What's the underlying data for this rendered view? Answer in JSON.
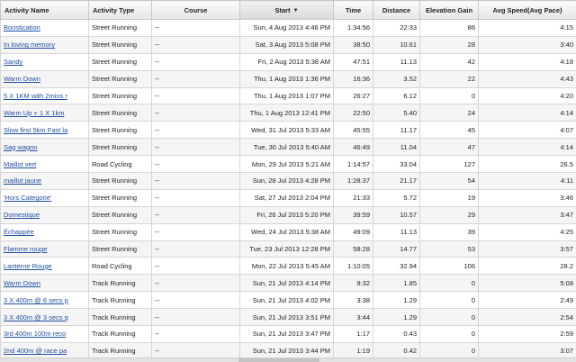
{
  "columns": {
    "name": "Activity Name",
    "type": "Activity Type",
    "course": "Course",
    "start": "Start",
    "time": "Time",
    "distance": "Distance",
    "elevation": "Elevation Gain",
    "speed": "Avg Speed(Avg Pace)"
  },
  "sort_icon": "sort-descending-icon",
  "rows": [
    {
      "name": "Bonstication",
      "type": "Street Running",
      "course": "--",
      "start": "Sun, 4 Aug 2013 4:46 PM",
      "time": "1:34:56",
      "distance": "22:33",
      "elevation": "86",
      "speed": "4:15"
    },
    {
      "name": "In loving memory",
      "type": "Street Running",
      "course": "--",
      "start": "Sat, 3 Aug 2013 5:08 PM",
      "time": "38:50",
      "distance": "10.61",
      "elevation": "28",
      "speed": "3:40"
    },
    {
      "name": "Sandy",
      "type": "Street Running",
      "course": "--",
      "start": "Fri, 2 Aug 2013 5:38 AM",
      "time": "47:51",
      "distance": "11.13",
      "elevation": "42",
      "speed": "4:18"
    },
    {
      "name": "Warm Down",
      "type": "Street Running",
      "course": "--",
      "start": "Thu, 1 Aug 2013 1:36 PM",
      "time": "16:36",
      "distance": "3.52",
      "elevation": "22",
      "speed": "4:43"
    },
    {
      "name": "5 X 1KM with 2mins r",
      "type": "Street Running",
      "course": "--",
      "start": "Thu, 1 Aug 2013 1:07 PM",
      "time": "26:27",
      "distance": "6.12",
      "elevation": "0",
      "speed": "4:20"
    },
    {
      "name": "Warm Up + 1 X 1km",
      "type": "Street Running",
      "course": "--",
      "start": "Thu, 1 Aug 2013 12:41 PM",
      "time": "22:50",
      "distance": "5.40",
      "elevation": "24",
      "speed": "4:14"
    },
    {
      "name": "Slow first 5km Fast la",
      "type": "Street Running",
      "course": "--",
      "start": "Wed, 31 Jul 2013 5:33 AM",
      "time": "45:55",
      "distance": "11.17",
      "elevation": "45",
      "speed": "4:07"
    },
    {
      "name": "Sag wagon",
      "type": "Street Running",
      "course": "--",
      "start": "Tue, 30 Jul 2013 5:40 AM",
      "time": "46:49",
      "distance": "11.04",
      "elevation": "47",
      "speed": "4:14"
    },
    {
      "name": "Maillot vert",
      "type": "Road Cycling",
      "course": "--",
      "start": "Mon, 29 Jul 2013 5:21 AM",
      "time": "1:14:57",
      "distance": "33.04",
      "elevation": "127",
      "speed": "26.5"
    },
    {
      "name": "maillot jaune",
      "type": "Street Running",
      "course": "--",
      "start": "Sun, 28 Jul 2013 4:28 PM",
      "time": "1:28:37",
      "distance": "21.17",
      "elevation": "54",
      "speed": "4:11"
    },
    {
      "name": "'Hors Categorie'",
      "type": "Street Running",
      "course": "--",
      "start": "Sat, 27 Jul 2013 2:04 PM",
      "time": "21:33",
      "distance": "5.72",
      "elevation": "19",
      "speed": "3:46"
    },
    {
      "name": "Domestique",
      "type": "Street Running",
      "course": "--",
      "start": "Fri, 26 Jul 2013 5:20 PM",
      "time": "39:59",
      "distance": "10.57",
      "elevation": "29",
      "speed": "3:47"
    },
    {
      "name": "Échappée",
      "type": "Street Running",
      "course": "--",
      "start": "Wed, 24 Jul 2013 5:38 AM",
      "time": "49:09",
      "distance": "11.13",
      "elevation": "39",
      "speed": "4:25"
    },
    {
      "name": "Flamme rouge",
      "type": "Street Running",
      "course": "--",
      "start": "Tue, 23 Jul 2013 12:28 PM",
      "time": "58:28",
      "distance": "14.77",
      "elevation": "53",
      "speed": "3:57"
    },
    {
      "name": "Lanterne Rouge",
      "type": "Road Cycling",
      "course": "--",
      "start": "Mon, 22 Jul 2013 5:45 AM",
      "time": "1:10:05",
      "distance": "32.94",
      "elevation": "106",
      "speed": "28.2"
    },
    {
      "name": "Warm Down",
      "type": "Track Running",
      "course": "--",
      "start": "Sun, 21 Jul 2013 4:14 PM",
      "time": "9:32",
      "distance": "1.85",
      "elevation": "0",
      "speed": "5:08"
    },
    {
      "name": "3 X 400m @ 6 secs p",
      "type": "Track Running",
      "course": "--",
      "start": "Sun, 21 Jul 2013 4:02 PM",
      "time": "3:38",
      "distance": "1.29",
      "elevation": "0",
      "speed": "2:49"
    },
    {
      "name": "3 X 400m @ 3 secs q",
      "type": "Track Running",
      "course": "--",
      "start": "Sun, 21 Jul 2013 3:51 PM",
      "time": "3:44",
      "distance": "1.29",
      "elevation": "0",
      "speed": "2:54"
    },
    {
      "name": "3rd 400m 100m reco",
      "type": "Track Running",
      "course": "--",
      "start": "Sun, 21 Jul 2013 3:47 PM",
      "time": "1:17",
      "distance": "0.43",
      "elevation": "0",
      "speed": "2:59"
    },
    {
      "name": "2nd 400m @ race pa",
      "type": "Track Running",
      "course": "--",
      "start": "Sun, 21 Jul 2013 3:44 PM",
      "time": "1:19",
      "distance": "0.42",
      "elevation": "0",
      "speed": "3:07"
    }
  ]
}
